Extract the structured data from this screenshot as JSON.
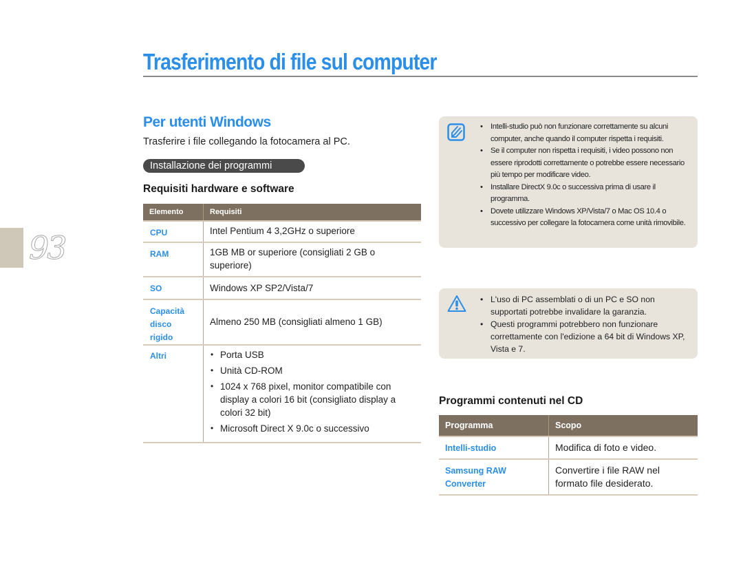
{
  "page": {
    "number": "93",
    "title": "Trasferimento di file sul computer"
  },
  "section": {
    "title": "Per utenti Windows",
    "intro": "Trasferire i file collegando la fotocamera al PC.",
    "pill_label": "Installazione dei programmi"
  },
  "requirements": {
    "heading": "Requisiti hardware e software",
    "columns": [
      "Elemento",
      "Requisiti"
    ],
    "rows": [
      {
        "item": "CPU",
        "value": "Intel Pentium 4 3,2GHz o superiore"
      },
      {
        "item": "RAM",
        "value": "1GB MB or superiore (consigliati 2 GB o superiore)"
      },
      {
        "item": "SO",
        "value": "Windows XP SP2/Vista/7"
      },
      {
        "item_lines": [
          "Capacità",
          "disco",
          "rigido"
        ],
        "value": "Almeno 250 MB (consigliati almeno 1 GB)"
      },
      {
        "item": "Altri",
        "bullets": [
          "Porta USB",
          "Unità CD-ROM",
          "1024 x 768 pixel, monitor compatibile con display a colori 16 bit (consigliato display a colori 32 bit)",
          "Microsoft Direct X 9.0c o successivo"
        ]
      }
    ]
  },
  "notes": {
    "icon": "note-pencil-icon",
    "items": [
      "Intelli-studio può non funzionare correttamente su alcuni computer, anche quando il computer rispetta i requisiti.",
      "Se il computer non rispetta i requisiti, i video possono non essere riprodotti correttamente o potrebbe essere necessario più tempo per modificare video.",
      "Installare DirectX 9.0c o successiva prima di usare il programma.",
      "Dovete utilizzare Windows XP/Vista/7 o Mac OS 10.4 o successivo per collegare la fotocamera come unità rimovibile."
    ]
  },
  "warnings": {
    "icon": "warning-triangle-icon",
    "items": [
      "L'uso di PC assemblati o di un PC e SO non supportati potrebbe invalidare la garanzia.",
      "Questi programmi potrebbero non funzionare correttamente con l'edizione a 64 bit di Windows XP, Vista e 7."
    ]
  },
  "programs": {
    "heading": "Programmi contenuti nel CD",
    "columns": [
      "Programma",
      "Scopo"
    ],
    "rows": [
      {
        "name_lines": [
          "Intelli-studio"
        ],
        "purpose": "Modifica di foto e video."
      },
      {
        "name_lines": [
          "Samsung RAW",
          "Converter"
        ],
        "purpose": "Convertire i file RAW nel formato file desiderato."
      }
    ]
  },
  "colors": {
    "accent": "#2b8fe9",
    "table_header": "#7d7060",
    "note_bg": "#e8e4dc",
    "page_tab": "#cfc7b8"
  }
}
